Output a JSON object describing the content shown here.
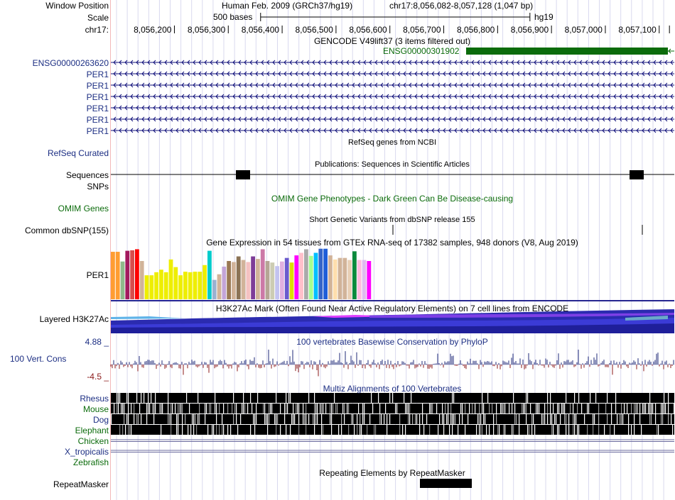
{
  "labels": {
    "window_position": "Window Position",
    "scale": "Scale",
    "chrom": "chr17:",
    "gencode_gene1": "ENSG00000263620",
    "per1": "PER1",
    "refseq": "RefSeq Curated",
    "sequences": "Sequences",
    "snps": "SNPs",
    "omim": "OMIM Genes",
    "common_dbsnp": "Common dbSNP(155)",
    "gtex_gene": "PER1",
    "layered": "Layered H3K27Ac",
    "cons_max": "4.88 _",
    "cons_name": "100 Vert. Cons",
    "cons_min": "-4.5 _",
    "rhesus": "Rhesus",
    "mouse": "Mouse",
    "dog": "Dog",
    "elephant": "Elephant",
    "chicken": "Chicken",
    "xtrop": "X_tropicalis",
    "zebrafish": "Zebrafish",
    "repeatmasker": "RepeatMasker"
  },
  "header": {
    "assembly": "Human Feb. 2009 (GRCh37/hg19)",
    "position": "chr17:8,056,082-8,057,128 (1,047 bp)",
    "scale_text": "500 bases",
    "scale_db": "hg19",
    "ticks": [
      "8,056,200",
      "8,056,300",
      "8,056,400",
      "8,056,500",
      "8,056,600",
      "8,056,700",
      "8,056,800",
      "8,056,900",
      "8,057,000",
      "8,057,100"
    ]
  },
  "titles": {
    "gencode": "GENCODE V49lift37 (3 items filtered out)",
    "gencode_gene2": "ENSG00000301902",
    "refseq": "RefSeq genes from NCBI",
    "publications": "Publications: Sequences in Scientific Articles",
    "omim": "OMIM Gene Phenotypes - Dark Green Can Be Disease-causing",
    "dbsnp": "Short Genetic Variants from dbSNP release 155",
    "gtex": "Gene Expression in 54 tissues from GTEx RNA-seq of 17382 samples, 948 donors (V8, Aug 2019)",
    "h3k27ac": "H3K27Ac Mark (Often Found Near Active Regulatory Elements) on 7 cell lines from ENCODE",
    "phylop": "100 vertebrates Basewise Conservation by PhyloP",
    "multiz": "Multiz Alignments of 100 Vertebrates",
    "repeat": "Repeating Elements by RepeatMasker"
  },
  "gtex": {
    "values": [
      0.93,
      0.93,
      0.74,
      0.95,
      0.96,
      0.98,
      0.75,
      0.47,
      0.47,
      0.53,
      0.58,
      0.53,
      0.78,
      0.63,
      0.47,
      0.54,
      0.53,
      0.54,
      0.54,
      0.67,
      0.95,
      0.38,
      0.49,
      0.64,
      0.75,
      0.73,
      0.84,
      0.77,
      0.73,
      0.84,
      0.79,
      0.98,
      0.75,
      0.72,
      0.65,
      0.74,
      0.81,
      0.72,
      0.86,
      0.91,
      0.98,
      0.85,
      0.91,
      0.99,
      0.99,
      0.86,
      0.78,
      0.81,
      0.81,
      0.77,
      0.94,
      0.77,
      0.77,
      0.75
    ],
    "colors": [
      "#ff9d32",
      "#ff9d32",
      "#8fb98b",
      "#a3195e",
      "#d74d4d",
      "#ff0000",
      "#d1b399",
      "#eeee00",
      "#eeee00",
      "#eeee00",
      "#eeee00",
      "#eeee00",
      "#eeee00",
      "#eeee00",
      "#eeee00",
      "#eeee00",
      "#eeee00",
      "#eeee00",
      "#eeee00",
      "#eeee00",
      "#00cccc",
      "#99b1d1",
      "#d1b399",
      "#c4a5d8",
      "#9a7954",
      "#d1b399",
      "#8b7355",
      "#d1b399",
      "#f4c1c1",
      "#7d3c98",
      "#d1b399",
      "#cc79a7",
      "#b5a595",
      "#ccccb3",
      "#c3c3f0",
      "#e0b0e0",
      "#6a5acd",
      "#dddd00",
      "#ff00ff",
      "#ffc0cb",
      "#aaaaaa",
      "#a6ff8f",
      "#00bfff",
      "#3565c8",
      "#1f5ed8",
      "#d1b399",
      "#ffdead",
      "#d1b399",
      "#d1b399",
      "#e8cfb5",
      "#0b8a3c",
      "#ffbbdd",
      "#e0bbee",
      "#ff00ff"
    ]
  },
  "colors": {
    "label_blue": "#1c2e83",
    "label_green": "#0b6b0b",
    "gene_navy": "#0c0c78",
    "gencode_green": "#0b6b0b",
    "phylop_pos": "#1f2a7a",
    "phylop_neg": "#8b1a1a",
    "h3k27ac_navy": "#252590"
  }
}
